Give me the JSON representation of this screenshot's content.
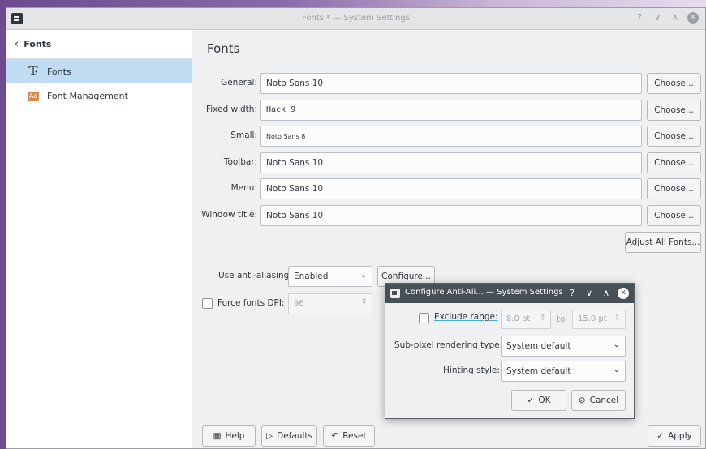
{
  "window": {
    "title": "Fonts * — System Settings",
    "controls": {
      "help": "?",
      "minimize": "∨",
      "maximize": "∧",
      "close": "✕"
    }
  },
  "sidebar": {
    "back_label": "Fonts",
    "items": [
      {
        "label": "Fonts",
        "icon": "font-icon",
        "active": true
      },
      {
        "label": "Font Management",
        "icon": "font-management-icon",
        "active": false
      }
    ]
  },
  "page": {
    "title": "Fonts",
    "font_rows": [
      {
        "label": "General:",
        "value": "Noto Sans 10",
        "button": "Choose..."
      },
      {
        "label": "Fixed width:",
        "value": "Hack 9",
        "button": "Choose..."
      },
      {
        "label": "Small:",
        "value": "Noto Sans 8",
        "button": "Choose..."
      },
      {
        "label": "Toolbar:",
        "value": "Noto Sans 10",
        "button": "Choose..."
      },
      {
        "label": "Menu:",
        "value": "Noto Sans 10",
        "button": "Choose..."
      },
      {
        "label": "Window title:",
        "value": "Noto Sans 10",
        "button": "Choose..."
      }
    ],
    "adjust_all_label": "Adjust All Fonts...",
    "antialiasing": {
      "label": "Use anti-aliasing:",
      "value": "Enabled",
      "configure_label": "Configure..."
    },
    "force_dpi": {
      "label": "Force fonts DPI:",
      "value": "96",
      "checked": false
    }
  },
  "footer": {
    "help_label": "Help",
    "defaults_label": "Defaults",
    "reset_label": "Reset",
    "apply_label": "Apply"
  },
  "dialog": {
    "title": "Configure Anti-Ali... — System Settings",
    "controls": {
      "help": "?",
      "minimize": "∨",
      "maximize": "∧",
      "close": "✕"
    },
    "exclude_range": {
      "label": "Exclude range:",
      "from": "8.0 pt",
      "to_label": "to",
      "to": "15.0 pt",
      "checked": false
    },
    "subpixel": {
      "label": "Sub-pixel rendering type:",
      "value": "System default"
    },
    "hinting": {
      "label": "Hinting style:",
      "value": "System default"
    },
    "ok_label": "OK",
    "cancel_label": "Cancel"
  }
}
